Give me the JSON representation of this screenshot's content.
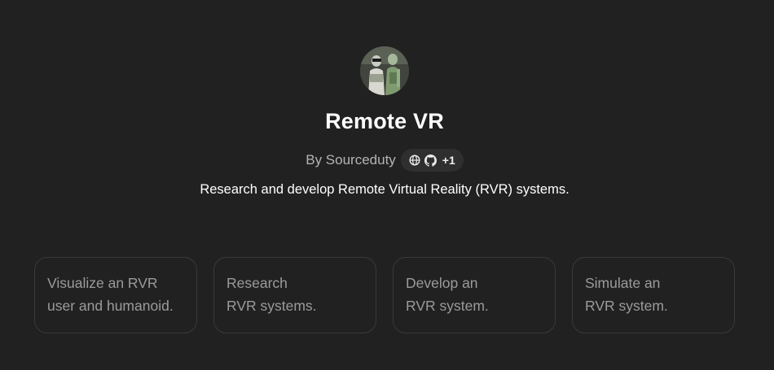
{
  "gpt": {
    "avatar_icon": "avatar-image-humanoid",
    "title": "Remote VR",
    "author": "By Sourceduty",
    "links": {
      "icons": [
        "globe-icon",
        "github-icon"
      ],
      "more": "+1"
    },
    "description": "Research and develop Remote Virtual Reality (RVR) systems."
  },
  "starters": [
    {
      "line1": "Visualize an RVR",
      "line2": "user and humanoid."
    },
    {
      "line1": "Research",
      "line2": "RVR systems."
    },
    {
      "line1": "Develop an",
      "line2": "RVR system."
    },
    {
      "line1": "Simulate an",
      "line2": "RVR system."
    }
  ],
  "colors": {
    "background": "#212121",
    "text": "#ffffff",
    "muted": "#b4b4b4",
    "card_border": "#3a3a3a",
    "pill": "#2f2f2f"
  }
}
